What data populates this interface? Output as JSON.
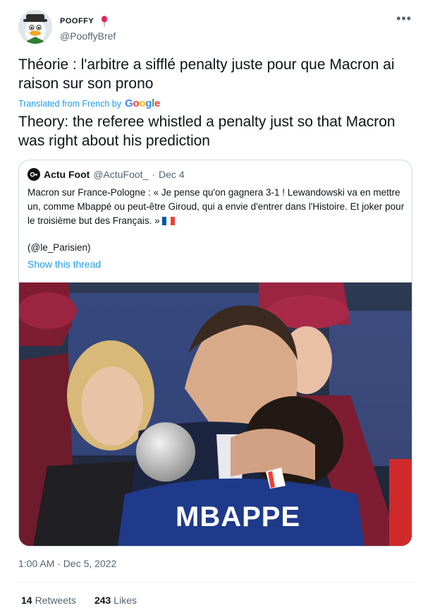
{
  "author": {
    "display_name": "POOFFY",
    "handle": "@PooffyBref",
    "avatar_icon": "duck-avatar-icon",
    "badge_icon": "red-balloon-icon"
  },
  "menu": {
    "more_label": "•••"
  },
  "tweet": {
    "text": "Théorie : l'arbitre a sifflé penalty juste pour que Macron ai raison sur son prono",
    "translated_label": "Translated from French by",
    "translator_brand": [
      "G",
      "o",
      "o",
      "g",
      "l",
      "e"
    ],
    "translation": "Theory: the referee whistled a penalty just so that Macron was right about his prediction"
  },
  "quoted_tweet": {
    "display_name": "Actu Foot",
    "handle": "@ActuFoot_",
    "separator": "·",
    "date": "Dec 4",
    "text": "Macron sur France-Pologne : « Je pense qu'on gagnera 3-1 ! Lewandowski va en mettre un, comme Mbappé ou peut-être Giroud, qui a envie d'entrer dans l'Histoire. Et joker pour le troisième but des Français. »",
    "source": "(@le_Parisien)",
    "show_thread": "Show this thread",
    "jersey_text": "MBAPPE"
  },
  "meta": {
    "timestamp": "1:00 AM · Dec 5, 2022"
  },
  "stats": {
    "retweets_count": "14",
    "retweets_label": "Retweets",
    "likes_count": "243",
    "likes_label": "Likes"
  },
  "colors": {
    "link": "#1d9bf0",
    "muted": "#536471",
    "border": "#cfd9de",
    "jersey": "#1f3a8a"
  }
}
